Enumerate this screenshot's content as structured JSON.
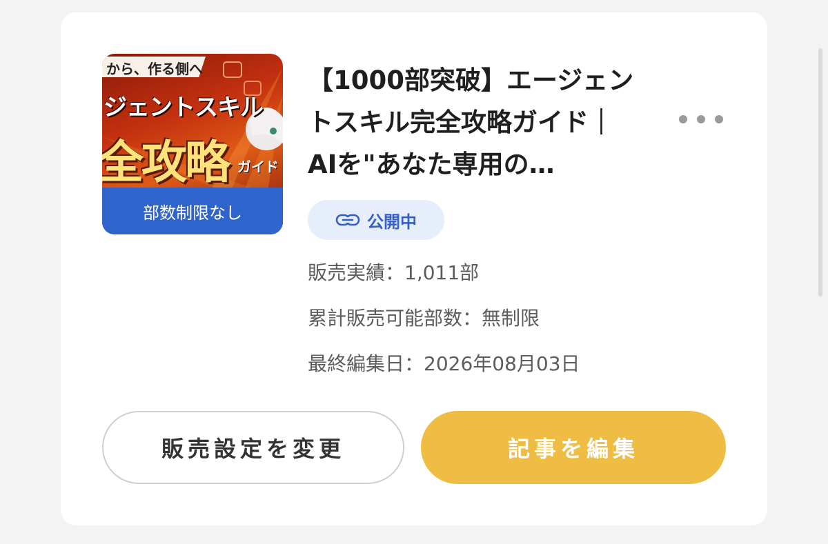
{
  "article": {
    "title": "【1000部突破】エージェントスキル完全攻略ガイド｜AIを\"あなた専用の…",
    "thumbnail": {
      "top_text": "から、作る側へ",
      "line1": "ジェントスキル",
      "line2": "全攻略",
      "line3": "ガイド",
      "bar_text": "部数制限なし"
    },
    "status": {
      "label": "公開中",
      "icon": "link-icon"
    },
    "sales": "販売実績：1,011部",
    "limit": "累計販売可能部数：無制限",
    "last_edited": "最終編集日：2026年08月03日"
  },
  "actions": {
    "change_settings": "販売設定を変更",
    "edit_article": "記事を編集"
  },
  "colors": {
    "accent": "#efbd44",
    "badge_bg": "#e7eefb",
    "badge_text": "#3460c4"
  }
}
